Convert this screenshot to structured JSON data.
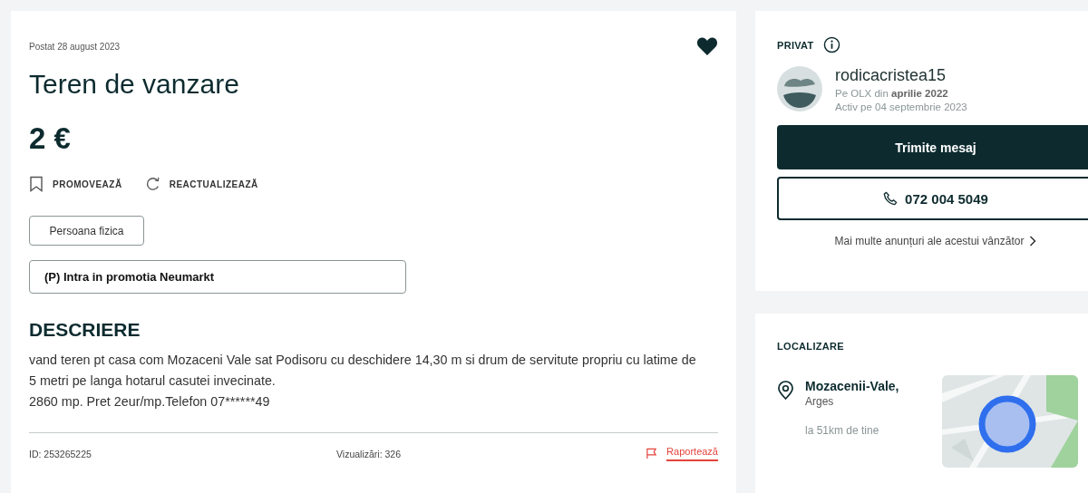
{
  "ad": {
    "posted": "Postat 28 august 2023",
    "title": "Teren de vanzare",
    "price": "2 €",
    "actions": [
      {
        "kind": "promote",
        "label": "PROMOVEAZĂ"
      },
      {
        "kind": "refresh",
        "label": "REACTUALIZEAZĂ"
      }
    ],
    "tag": "Persoana fizica",
    "promo": "(P) Intra in promotia Neumarkt",
    "description_heading": "DESCRIERE",
    "description": "vand teren pt casa com Mozaceni Vale sat Podisoru cu deschidere 14,30 m si drum de servitute propriu cu latime de 5 metri pe langa hotarul casutei invecinate.\n2860 mp. Pret 2eur/mp.Telefon 07******49",
    "id": "ID: 253265225",
    "views": "Vizualizări: 326",
    "report": "Raportează"
  },
  "seller": {
    "type": "PRIVAT",
    "name": "rodicacristea15",
    "since": "Pe OLX din **aprilie 2022**",
    "active": "Activ pe 04 septembrie 2023",
    "message_button": "Trimite mesaj",
    "phone": "072 004 5049",
    "more_ads": "Mai multe anunțuri ale acestui vânzător"
  },
  "location": {
    "heading": "LOCALIZARE",
    "city": "Mozacenii-Vale,",
    "county": "Arges",
    "distance": "la 51km de tine"
  }
}
